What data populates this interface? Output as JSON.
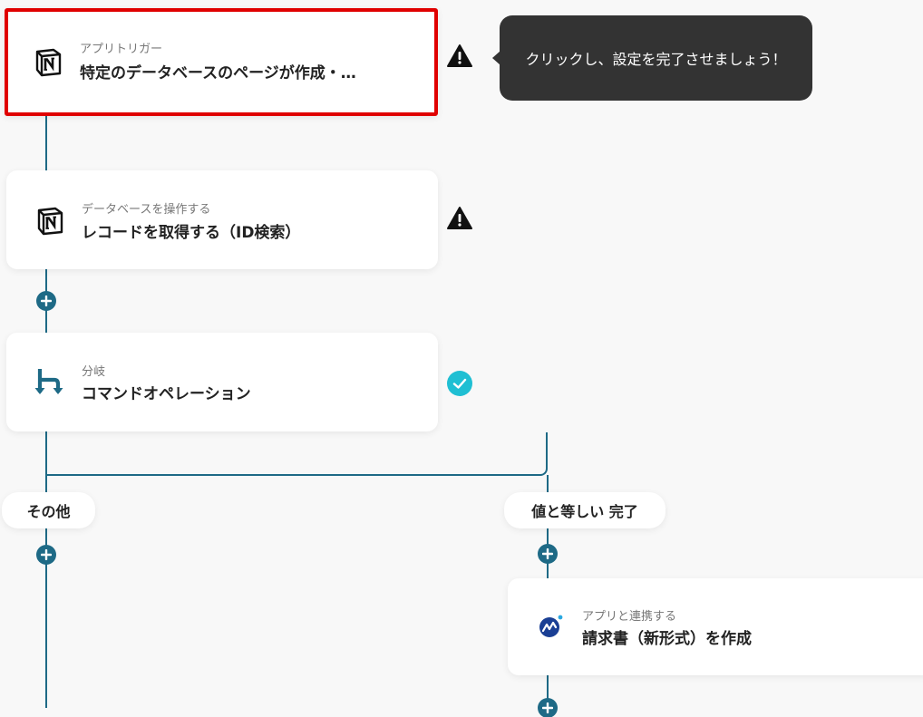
{
  "colors": {
    "connector": "#1e6a86",
    "selected_border": "#e00000",
    "tooltip_bg": "#333333",
    "success": "#1fbfd3",
    "background": "#f8f8f8"
  },
  "steps": [
    {
      "meta": "アプリトリガー",
      "title": "特定のデータベースのページが作成・…",
      "icon": "notion-icon",
      "status": "warning-icon"
    },
    {
      "meta": "データベースを操作する",
      "title": "レコードを取得する（ID検索）",
      "icon": "notion-icon",
      "status": "warning-icon"
    },
    {
      "meta": "分岐",
      "title": "コマンドオペレーション",
      "icon": "branch-icon",
      "status": "check-icon"
    },
    {
      "meta": "アプリと連携する",
      "title": "請求書（新形式）を作成",
      "icon": "misoca-icon"
    }
  ],
  "branches": {
    "left_label": "その他",
    "right_label": "値と等しい 完了"
  },
  "tooltip": {
    "text": "クリックし、設定を完了させましょう！"
  }
}
